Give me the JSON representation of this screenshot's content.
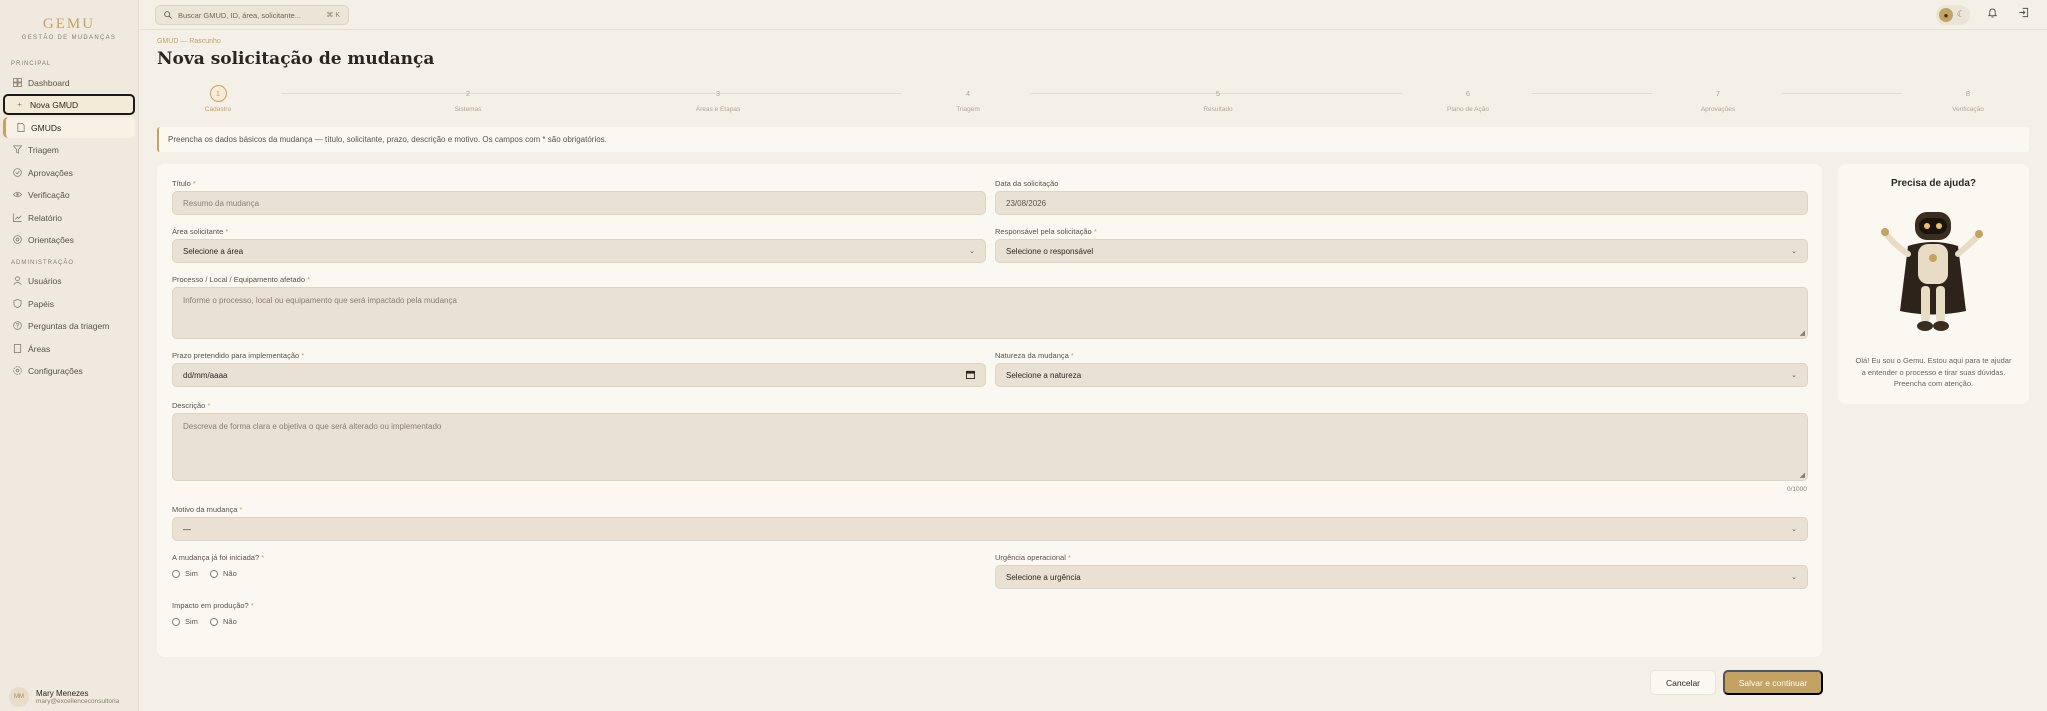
{
  "brand": {
    "name": "GEMU",
    "tagline": "GESTÃO DE MUDANÇAS"
  },
  "sidebar": {
    "sections": [
      {
        "label": "PRINCIPAL"
      },
      {
        "label": "ADMINISTRAÇÃO"
      }
    ],
    "items": [
      {
        "label": "Dashboard",
        "icon": "grid-icon"
      },
      {
        "label": "Nova GMUD",
        "icon": "plus-icon"
      },
      {
        "label": "GMUDs",
        "icon": "document-icon"
      },
      {
        "label": "Triagem",
        "icon": "filter-icon"
      },
      {
        "label": "Aprovações",
        "icon": "check-circle-icon"
      },
      {
        "label": "Verificação",
        "icon": "eye-icon"
      },
      {
        "label": "Relatório",
        "icon": "chart-icon"
      },
      {
        "label": "Orientações",
        "icon": "help-icon"
      },
      {
        "label": "Usuários",
        "icon": "user-icon"
      },
      {
        "label": "Papéis",
        "icon": "shield-icon"
      },
      {
        "label": "Perguntas da triagem",
        "icon": "question-icon"
      },
      {
        "label": "Áreas",
        "icon": "building-icon"
      },
      {
        "label": "Configurações",
        "icon": "gear-icon"
      }
    ],
    "user": {
      "initials": "MM",
      "name": "Mary Menezes",
      "email": "mary@excellenceconsultoria"
    }
  },
  "topbar": {
    "search_placeholder": "Buscar GMUD, ID, área, solicitante...",
    "search_shortcut": "⌘ K"
  },
  "header": {
    "breadcrumb": "GMUD — Rascunho",
    "title": "Nova solicitação de mudança"
  },
  "stepper": [
    {
      "num": "1",
      "label": "Cadastro"
    },
    {
      "num": "2",
      "label": "Sistemas"
    },
    {
      "num": "3",
      "label": "Áreas e Etapas"
    },
    {
      "num": "4",
      "label": "Triagem"
    },
    {
      "num": "5",
      "label": "Resultado"
    },
    {
      "num": "6",
      "label": "Plano de Ação"
    },
    {
      "num": "7",
      "label": "Aprovações"
    },
    {
      "num": "8",
      "label": "Verificação"
    }
  ],
  "info_text": "Preencha os dados básicos da mudança — título, solicitante, prazo, descrição e motivo. Os campos com * são obrigatórios.",
  "form": {
    "titulo": {
      "label": "Título",
      "placeholder": "Resumo da mudança"
    },
    "data": {
      "label": "Data da solicitação",
      "value": "23/08/2026"
    },
    "area": {
      "label": "Área solicitante",
      "value": "Selecione a área"
    },
    "responsavel": {
      "label": "Responsável pela solicitação",
      "value": "Selecione o responsável"
    },
    "processo": {
      "label": "Processo / Local / Equipamento afetado",
      "placeholder": "Informe o processo, local ou equipamento que será impactado pela mudança"
    },
    "prazo": {
      "label": "Prazo pretendido para implementação",
      "value": "dd/mm/aaaa"
    },
    "natureza": {
      "label": "Natureza da mudança",
      "value": "Selecione a natureza"
    },
    "descricao": {
      "label": "Descrição",
      "placeholder": "Descreva de forma clara e objetiva o que será alterado ou implementado",
      "counter": "0/1000"
    },
    "motivo": {
      "label": "Motivo da mudança",
      "value": "—"
    },
    "iniciada": {
      "label": "A mudança já foi iniciada?",
      "options": [
        "Sim",
        "Não"
      ]
    },
    "urgencia": {
      "label": "Urgência operacional",
      "value": "Selecione a urgência"
    },
    "impacto": {
      "label": "Impacto em produção?",
      "options": [
        "Sim",
        "Não"
      ]
    },
    "required_mark": "*"
  },
  "help": {
    "title": "Precisa de ajuda?",
    "text": "Olá! Eu sou o Gemu. Estou aqui para te ajudar a entender o processo e tirar suas dúvidas. Preencha com atenção."
  },
  "actions": {
    "cancel": "Cancelar",
    "save": "Salvar e continuar"
  },
  "colors": {
    "accent": "#c4a262",
    "background": "#f4f0e8",
    "card": "#fbf8f2"
  }
}
